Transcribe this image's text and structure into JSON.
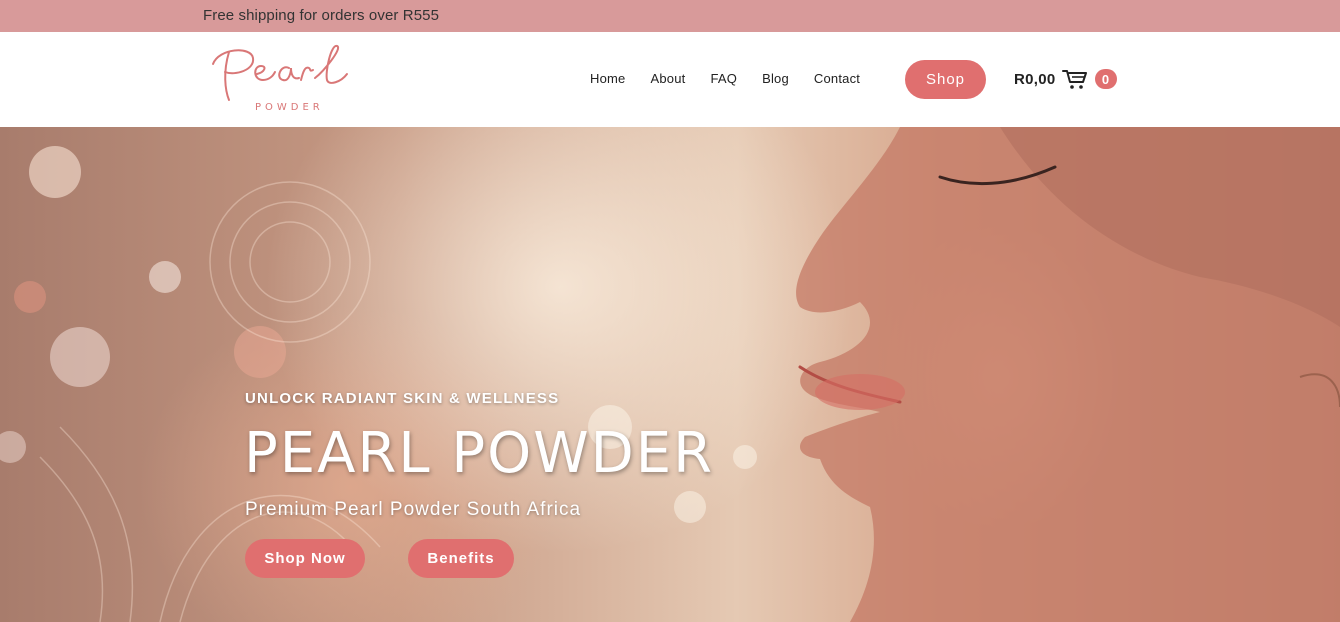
{
  "topbar": {
    "text": "Free shipping for orders over R555"
  },
  "logo": {
    "script": "Pearl",
    "sub": "POWDER"
  },
  "nav": {
    "items": [
      {
        "label": "Home"
      },
      {
        "label": "About"
      },
      {
        "label": "FAQ"
      },
      {
        "label": "Blog"
      },
      {
        "label": "Contact"
      }
    ],
    "shop_label": "Shop"
  },
  "cart": {
    "total": "R0,00",
    "count": "0",
    "icon": "cart-icon"
  },
  "hero": {
    "tagline": "UNLOCK RADIANT SKIN & WELLNESS",
    "title": "PEARL POWDER",
    "subtitle": "Premium Pearl Powder South Africa",
    "shop_now_label": "Shop Now",
    "benefits_label": "Benefits"
  },
  "colors": {
    "accent": "#e06f6f",
    "topbar": "#d89a9a",
    "logo": "#d97777"
  }
}
